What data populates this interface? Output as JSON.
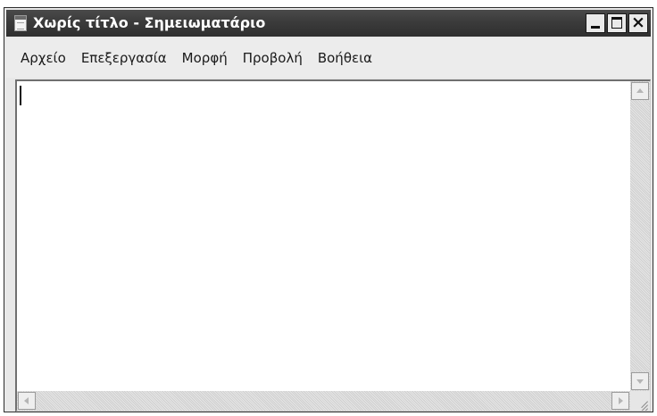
{
  "window": {
    "title": "Χωρίς τίτλο - Σημειωματάριο",
    "icon": "notepad-icon",
    "controls": {
      "minimize_icon": "minimize-icon",
      "maximize_icon": "maximize-icon",
      "close_icon": "close-icon",
      "close_glyph": "×"
    }
  },
  "menu": {
    "items": [
      {
        "label": "Αρχείο"
      },
      {
        "label": "Επεξεργασία"
      },
      {
        "label": "Μορφή"
      },
      {
        "label": "Προβολή"
      },
      {
        "label": "Βοήθεια"
      }
    ]
  },
  "editor": {
    "content": ""
  },
  "scrollbars": {
    "vertical": {
      "up_icon": "arrow-up-icon",
      "down_icon": "arrow-down-icon"
    },
    "horizontal": {
      "left_icon": "arrow-left-icon",
      "right_icon": "arrow-right-icon"
    },
    "resize_grip_icon": "resize-grip-icon"
  },
  "colors": {
    "titlebar": "#3b3b3b",
    "title_text": "#ffffff",
    "menubar": "#ececec",
    "editor_background": "#ffffff"
  }
}
